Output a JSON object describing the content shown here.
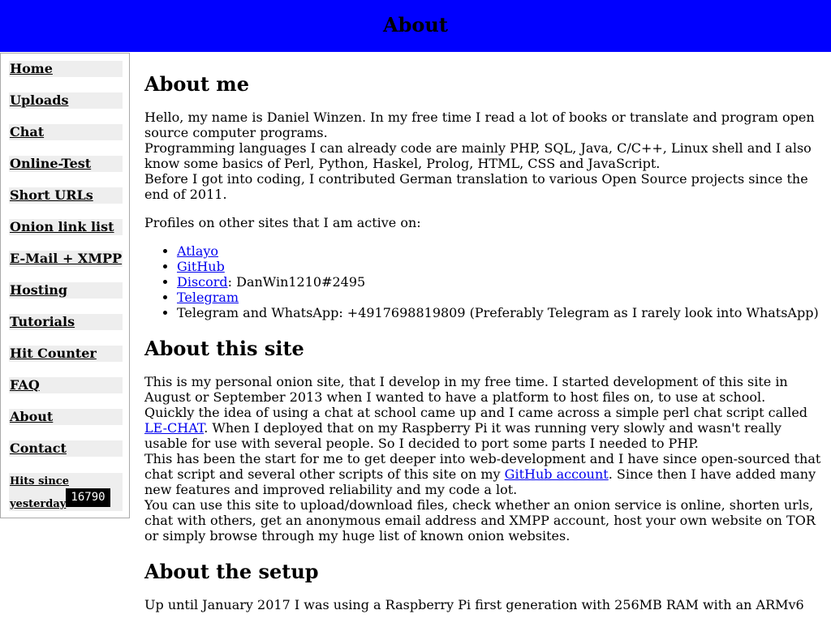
{
  "header": {
    "title": "About"
  },
  "menu": {
    "items": [
      "Home",
      "Uploads",
      "Chat",
      "Online-Test",
      "Short URLs",
      "Onion link list",
      "E-Mail + XMPP",
      "Hosting",
      "Tutorials",
      "Hit Counter",
      "FAQ",
      "About",
      "Contact"
    ],
    "hits_label_1": "Hits since",
    "hits_label_2": "yesterday",
    "hits_count": "16790"
  },
  "about_me": {
    "heading": "About me",
    "p1": "Hello, my name is Daniel Winzen. In my free time I read a lot of books or translate and program open source computer programs.",
    "p2": "Programming languages I can already code are mainly PHP, SQL, Java, C/C++, Linux shell and I also know some basics of Perl, Python, Haskel, Prolog, HTML, CSS and JavaScript.",
    "p3": "Before I got into coding, I contributed German translation to various Open Source projects since the end of 2011.",
    "profiles_intro": "Profiles on other sites that I am active on:",
    "profiles": {
      "atlayo": "Atlayo",
      "github": "GitHub",
      "discord": "Discord",
      "discord_handle": ": DanWin1210#2495",
      "telegram": "Telegram",
      "phone": "Telegram and WhatsApp: +4917698819809 (Preferably Telegram as I rarely look into WhatsApp)"
    }
  },
  "about_site": {
    "heading": "About this site",
    "p1": "This is my personal onion site, that I develop in my free time. I started development of this site in August or September 2013 when I wanted to have a platform to host files on, to use at school.",
    "p2a": "Quickly the idea of using a chat at school came up and I came across a simple perl chat script called ",
    "p2_link": "LE-CHAT",
    "p2b": ". When I deployed that on my Raspberry Pi it was running very slowly and wasn't really usable for use with several people. So I decided to port some parts I needed to PHP.",
    "p3a": "This has been the start for me to get deeper into web-development and I have since open-sourced that chat script and several other scripts of this site on my ",
    "p3_link": "GitHub account",
    "p3b": ". Since then I have added many new features and improved reliability and my code a lot.",
    "p4": "You can use this site to upload/download files, check whether an onion service is online, shorten urls, chat with others, get an anonymous email address and XMPP account, host your own website on TOR or simply browse through my huge list of known onion websites."
  },
  "about_setup": {
    "heading": "About the setup",
    "p1": "Up until January 2017 I was using a Raspberry Pi first generation with 256MB RAM with an ARMv6"
  }
}
